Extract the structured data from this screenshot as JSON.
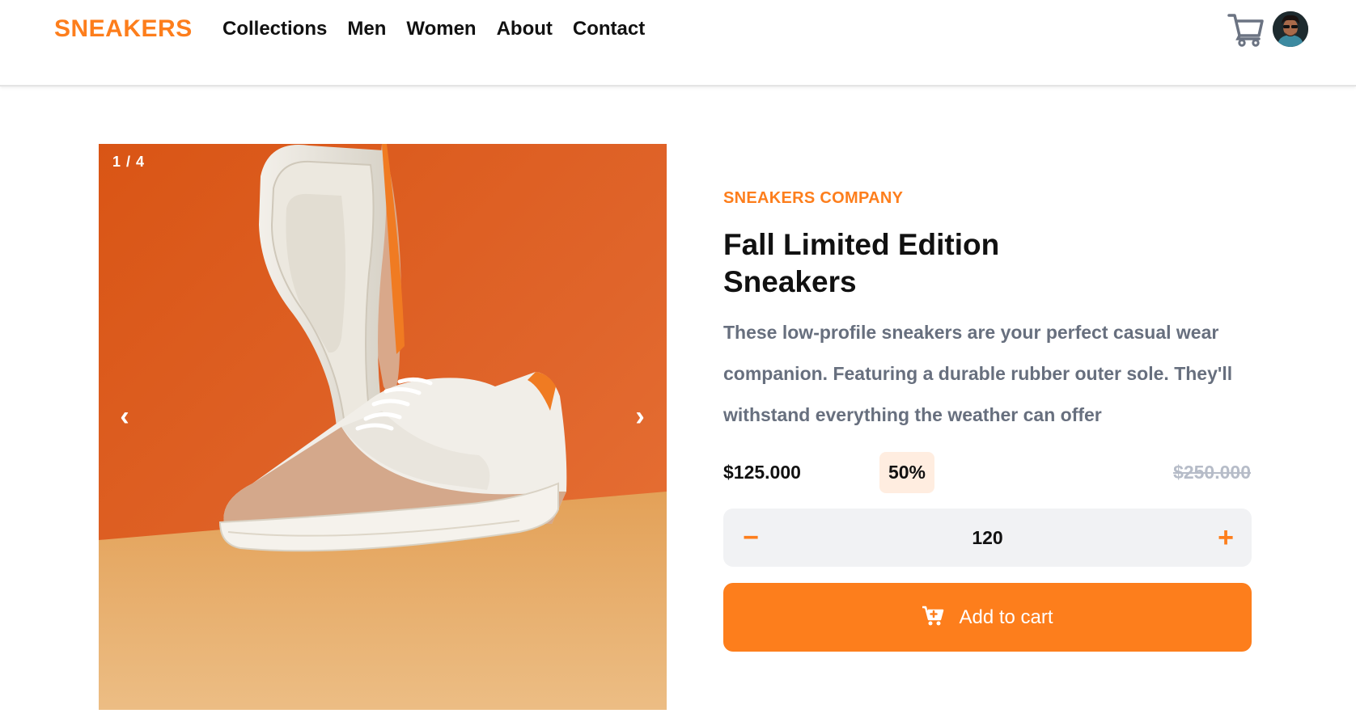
{
  "brand": {
    "logo": "SNEAKERS",
    "accent_color": "#fd7e1c"
  },
  "nav": {
    "items": [
      {
        "label": "Collections"
      },
      {
        "label": "Men"
      },
      {
        "label": "Women"
      },
      {
        "label": "About"
      },
      {
        "label": "Contact"
      }
    ]
  },
  "header_actions": {
    "cart_icon": "cart-icon",
    "avatar_icon": "user-avatar"
  },
  "gallery": {
    "counter": "1 / 4",
    "prev_arrow": "‹",
    "next_arrow": "›",
    "image": "white and tan sneakers on orange background"
  },
  "product": {
    "company": "SNEAKERS COMPANY",
    "title_line1": "Fall Limited Edition",
    "title_line2": "Sneakers",
    "description": "These low-profile sneakers are your perfect casual wear companion. Featuring a durable rubber outer sole. They'll withstand everything the weather can offer",
    "price": "$125.000",
    "discount": "50%",
    "original_price": "$250.000"
  },
  "quantity": {
    "minus": "−",
    "plus": "+",
    "value": "120"
  },
  "add_to_cart": {
    "label": "Add to cart",
    "icon": "cart-plus-icon"
  }
}
